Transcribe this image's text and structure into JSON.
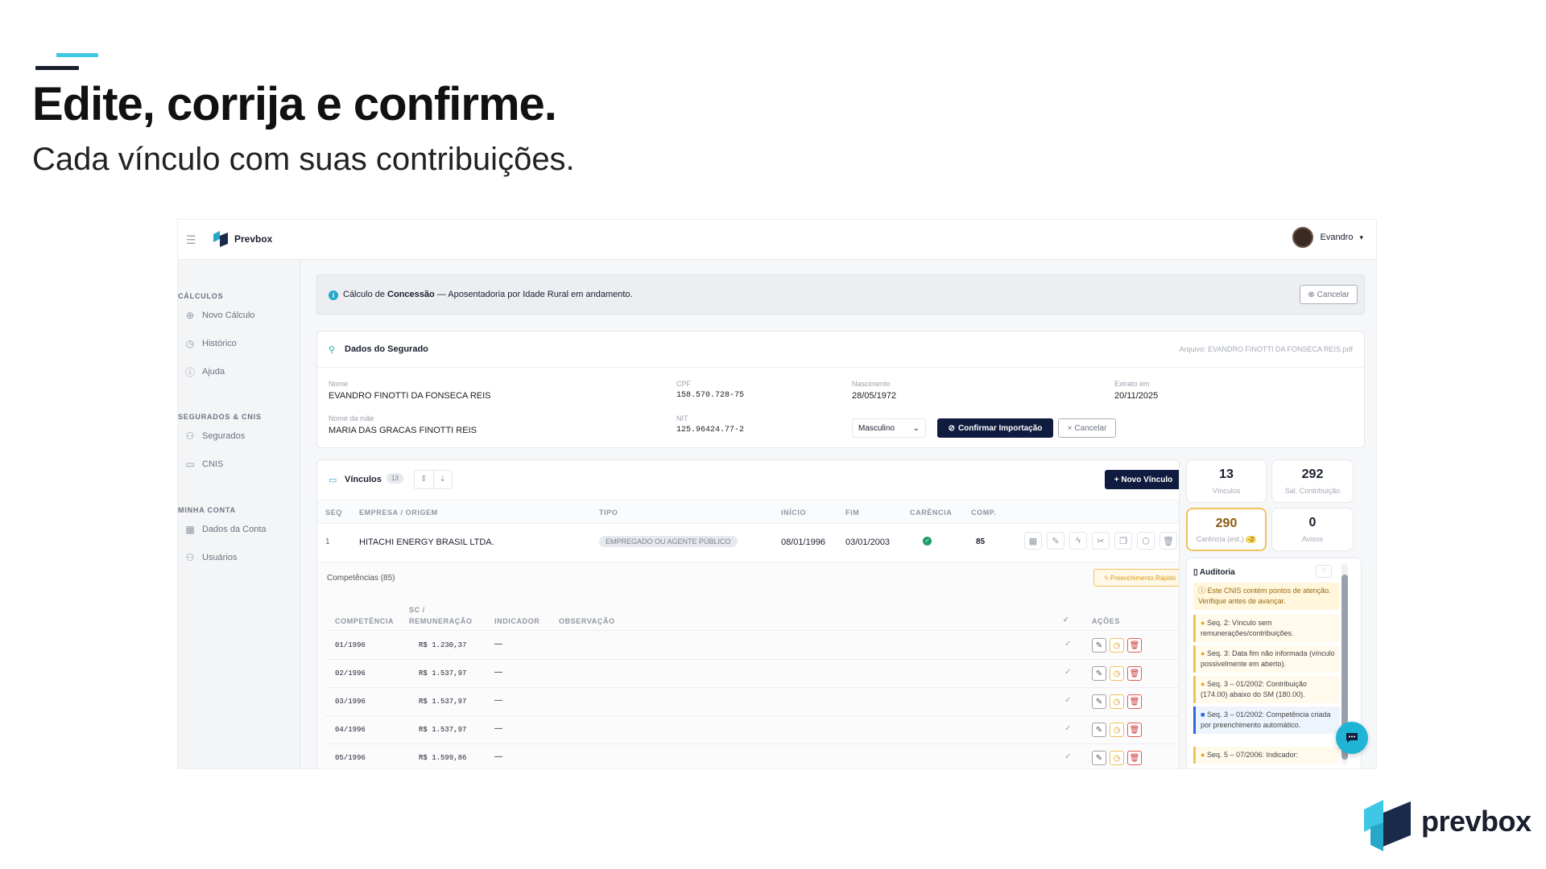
{
  "headline": "Edite, corrija e confirme.",
  "subline": "Cada vínculo com suas contribuições.",
  "colors": {
    "accent": "#3fc7e6",
    "dark": "#0f1c3f",
    "brand": "#1a1f2e"
  },
  "app": {
    "brand_name": "Prevbox",
    "user_name": "Evandro",
    "user_caret": "▾"
  },
  "sidebar": {
    "sections": [
      {
        "title": "CÁLCULOS",
        "items": [
          {
            "label": "Novo Cálculo",
            "icon": "plus-circle-icon"
          },
          {
            "label": "Histórico",
            "icon": "clock-icon"
          },
          {
            "label": "Ajuda",
            "icon": "help-icon"
          }
        ]
      },
      {
        "title": "SEGURADOS & CNIS",
        "items": [
          {
            "label": "Segurados",
            "icon": "users-icon"
          },
          {
            "label": "CNIS",
            "icon": "folder-icon"
          }
        ]
      },
      {
        "title": "MINHA CONTA",
        "items": [
          {
            "label": "Dados da Conta",
            "icon": "building-icon"
          },
          {
            "label": "Usuários",
            "icon": "users-icon"
          }
        ]
      }
    ]
  },
  "banner": {
    "prefix": "Cálculo de ",
    "bold": "Concessão",
    "suffix": " — Aposentadoria por Idade Rural em andamento.",
    "cancel": "Cancelar"
  },
  "segurado": {
    "title": "Dados do Segurado",
    "file": "Arquivo: EVANDRO FINOTTI DA FONSECA REIS.pdf",
    "nome_label": "Nome",
    "nome": "EVANDRO FINOTTI DA FONSECA REIS",
    "cpf_label": "CPF",
    "cpf": "158.570.728-75",
    "nasc_label": "Nascimento",
    "nasc": "28/05/1972",
    "extrato_label": "Extrato em",
    "extrato": "20/11/2025",
    "mae_label": "Nome da mãe",
    "mae": "MARIA DAS GRACAS FINOTTI REIS",
    "nit_label": "NIT",
    "nit": "125.96424.77-2",
    "sexo": "Masculino",
    "confirm": "Confirmar Importação",
    "cancel": "Cancelar"
  },
  "vinculos": {
    "title": "Vínculos",
    "count": "13",
    "novo": "+ Novo Vínculo",
    "headers": [
      "SEQ",
      "EMPRESA / ORIGEM",
      "TIPO",
      "INÍCIO",
      "FIM",
      "CARÊNCIA",
      "COMP."
    ],
    "row": {
      "seq": "1",
      "empresa": "HITACHI ENERGY BRASIL LTDA.",
      "tipo": "EMPREGADO OU AGENTE PÚBLICO",
      "inicio": "08/01/1996",
      "fim": "03/01/2003",
      "comp": "85"
    }
  },
  "competencias": {
    "title": "Competências (85)",
    "quick": "Preenchimento Rápido",
    "headers": {
      "comp": "COMPETÊNCIA",
      "sc1": "SC /",
      "sc2": "REMUNERAÇÃO",
      "ind": "INDICADOR",
      "obs": "OBSERVAÇÃO",
      "check": "✓",
      "acoes": "AÇÕES"
    },
    "rows": [
      {
        "comp": "01/1996",
        "valor": "R$ 1.230,37",
        "ind": "—"
      },
      {
        "comp": "02/1996",
        "valor": "R$ 1.537,97",
        "ind": "—"
      },
      {
        "comp": "03/1996",
        "valor": "R$ 1.537,97",
        "ind": "—"
      },
      {
        "comp": "04/1996",
        "valor": "R$ 1.537,97",
        "ind": "—"
      },
      {
        "comp": "05/1996",
        "valor": "R$ 1.599,86",
        "ind": "—"
      }
    ]
  },
  "stats": [
    {
      "value": "13",
      "label": "Vínculos"
    },
    {
      "value": "292",
      "label": "Sal. Contribuição"
    },
    {
      "value": "290",
      "label": "Carência (est.)",
      "badge": "-2"
    },
    {
      "value": "0",
      "label": "Avisos"
    }
  ],
  "auditoria": {
    "title": "Auditoria",
    "intro": "Este CNIS contém pontos de atenção. Verifique antes de avançar.",
    "notes": [
      {
        "text": "Seq. 2: Vínculo sem remunerações/contribuições.",
        "kind": "warn"
      },
      {
        "text": "Seq. 3: Data fim não informada (vínculo possivelmente em aberto).",
        "kind": "warn"
      },
      {
        "text": "Seq. 3 – 01/2002: Contribuição (174.00) abaixo do SM (180.00).",
        "kind": "warn"
      },
      {
        "text": "Seq. 3 – 01/2002: Competência criada por preenchimento automático.",
        "kind": "info"
      },
      {
        "text": "Seq. 5 – 07/2006: Indicador:",
        "kind": "warn"
      }
    ]
  },
  "footer_brand": "prevbox"
}
